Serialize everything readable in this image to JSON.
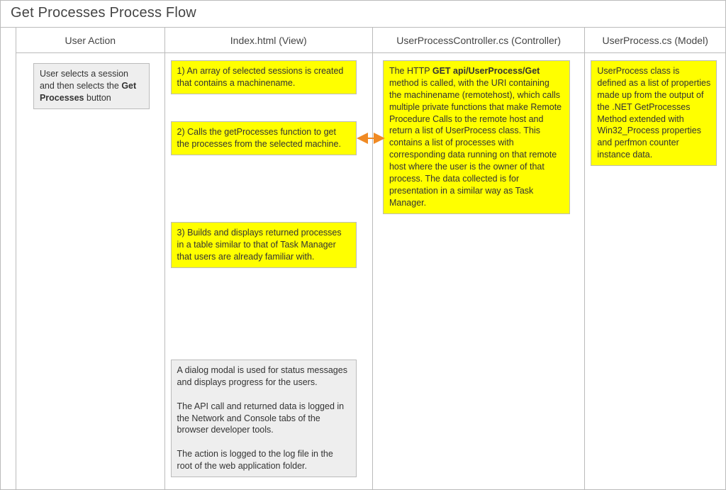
{
  "title": "Get Processes Process Flow",
  "lanes": {
    "userAction": {
      "header": "User Action"
    },
    "view": {
      "header": "Index.html (View)"
    },
    "controller": {
      "header": "UserProcessController.cs (Controller)"
    },
    "model": {
      "header": "UserProcess.cs (Model)"
    }
  },
  "notes": {
    "userActionNote_pre": "User selects a session and then selects the ",
    "userActionNote_bold": "Get Processes",
    "userActionNote_post": " button",
    "viewStep1": "1) An array of selected sessions is created that contains a machinename.",
    "viewStep2": "2) Calls the getProcesses function to get the processes from the selected machine.",
    "viewStep3": "3) Builds and displays returned processes in a table similar to that of Task Manager that users are already familiar with.",
    "viewFooterP1": "A dialog modal is used for status messages and displays progress for the users.",
    "viewFooterP2": "The API call and returned data is logged in the Network and Console tabs of the browser developer tools.",
    "viewFooterP3": "The action is logged to the log file in the root of the web application folder.",
    "controller_pre": "The HTTP ",
    "controller_bold": "GET api/UserProcess/Get",
    "controller_post": " method is called, with the URI containing the machinename (remotehost), which calls multiple private functions that make Remote Procedure Calls to the remote host and return a list of UserProcess class. This contains a list of processes with corresponding data running on that remote host where the user is the owner of that process. The data collected is for presentation in a similar way as Task Manager.",
    "modelNote": "UserProcess class is defined as a list of properties made up from the output of the .NET GetProcesses Method extended with Win32_Process properties and perfmon counter instance data."
  }
}
